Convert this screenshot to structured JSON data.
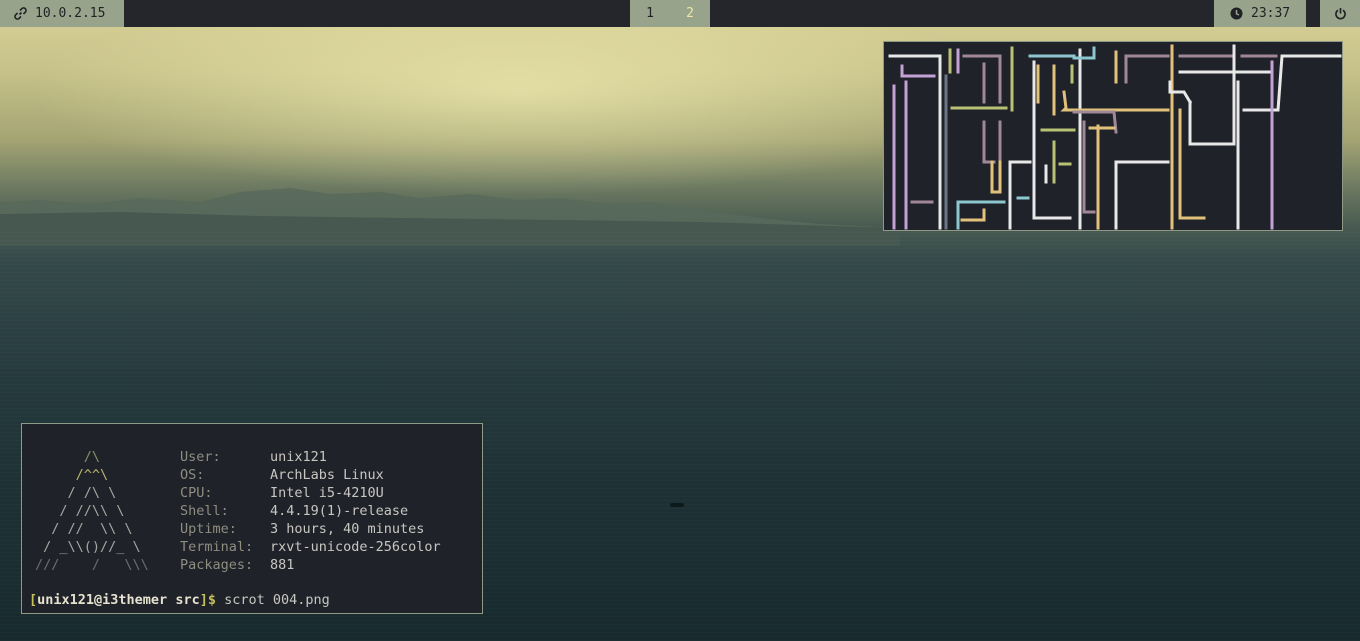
{
  "topbar": {
    "network": {
      "icon": "link-icon",
      "ip": "10.0.2.15"
    },
    "workspaces": [
      {
        "label": "1",
        "active": true
      },
      {
        "label": "2",
        "active": false
      }
    ],
    "clock": {
      "icon": "clock-icon",
      "time": "23:37"
    },
    "power": {
      "icon": "power-icon"
    }
  },
  "pipes_window": {
    "content": "pipes animation",
    "colors": [
      "#e8e8e8",
      "#c3a3d6",
      "#e0c27a",
      "#b9c174",
      "#8ec7cf",
      "#a08898"
    ]
  },
  "terminal": {
    "logo": [
      "/\\",
      "/^^\\",
      "/ /\\ \\",
      "/ //\\\\ \\",
      "/ //  \\\\ \\",
      "/ _\\\\()//_ \\",
      "///    /   \\\\\\"
    ],
    "info": [
      {
        "key": "User:",
        "value": "unix121"
      },
      {
        "key": "OS:",
        "value": "ArchLabs Linux"
      },
      {
        "key": "CPU:",
        "value": "Intel i5-4210U"
      },
      {
        "key": "Shell:",
        "value": "4.4.19(1)-release"
      },
      {
        "key": "Uptime:",
        "value": "3 hours, 40 minutes"
      },
      {
        "key": "Terminal:",
        "value": "rxvt-unicode-256color"
      },
      {
        "key": "Packages:",
        "value": "881"
      }
    ],
    "prompt": {
      "open": "[",
      "user": "unix121@i3themer",
      "dir": "src",
      "close": "]$",
      "command": " scrot 004.png"
    }
  },
  "colors": {
    "bar_bg": "#24262c",
    "bar_segment": "#97a38a",
    "terminal_bg": "#1f2229",
    "accent_yellow": "#c6c05a"
  }
}
